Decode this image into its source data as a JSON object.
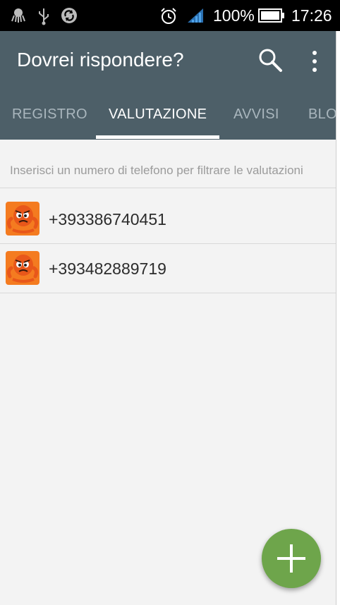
{
  "status_bar": {
    "battery_percent": "100%",
    "time": "17:26",
    "icons": [
      "octopus-icon",
      "usb-icon",
      "sync-icon",
      "alarm-icon",
      "signal-icon",
      "battery-icon"
    ]
  },
  "app_bar": {
    "title": "Dovrei rispondere?",
    "actions": [
      "search-icon",
      "more-vert-icon"
    ]
  },
  "tabs": [
    {
      "label": "REGISTRO",
      "active": false
    },
    {
      "label": "VALUTAZIONE",
      "active": true
    },
    {
      "label": "AVVISI",
      "active": false
    },
    {
      "label": "BLOC",
      "active": false
    }
  ],
  "filter": {
    "placeholder": "Inserisci un numero di telefono per filtrare le valutazioni",
    "value": ""
  },
  "ratings": [
    {
      "number": "+393386740451",
      "avatar": "orange-octopus-icon"
    },
    {
      "number": "+393482889719",
      "avatar": "orange-octopus-icon"
    }
  ],
  "fab": {
    "icon": "plus-icon"
  },
  "colors": {
    "app_bar": "#4d5f68",
    "background": "#f3f3f3",
    "fab": "#6ea54b",
    "avatar": "#f47b20"
  }
}
